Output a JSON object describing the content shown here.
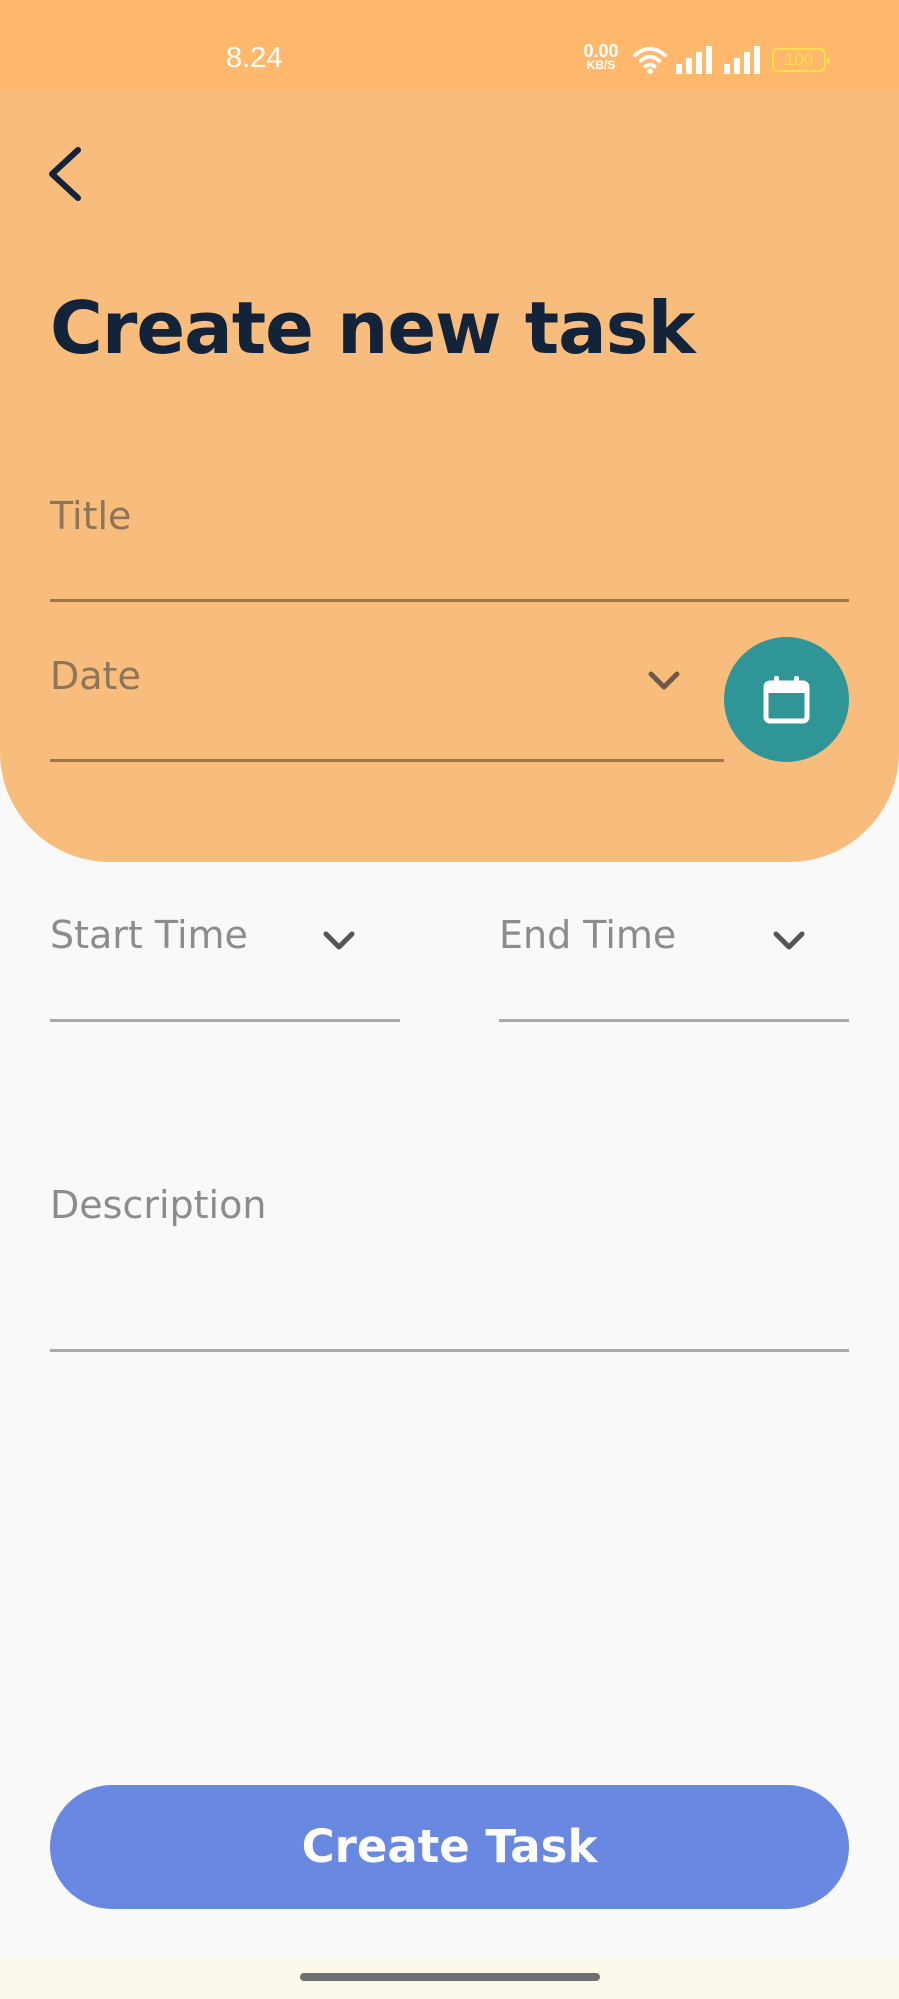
{
  "status_bar": {
    "time": "8.24",
    "net_speed_value": "0.00",
    "net_speed_unit": "KB/S",
    "battery": "100",
    "icons": [
      "wifi-icon",
      "signal-icon",
      "signal-icon",
      "battery-icon"
    ]
  },
  "header": {
    "back_icon": "back-arrow-icon",
    "title": "Create new task"
  },
  "form": {
    "title_placeholder": "Title",
    "date_placeholder": "Date",
    "calendar_icon": "calendar-icon",
    "start_time_placeholder": "Start Time",
    "end_time_placeholder": "End Time",
    "description_placeholder": "Description"
  },
  "actions": {
    "create_label": "Create Task"
  },
  "colors": {
    "status_bar": "#ffb86c",
    "header_bg": "#f8bd7c",
    "title_text": "#13243a",
    "calendar_button": "#2f9597",
    "create_button": "#6888e1",
    "page_bg": "#f9f9f9"
  }
}
